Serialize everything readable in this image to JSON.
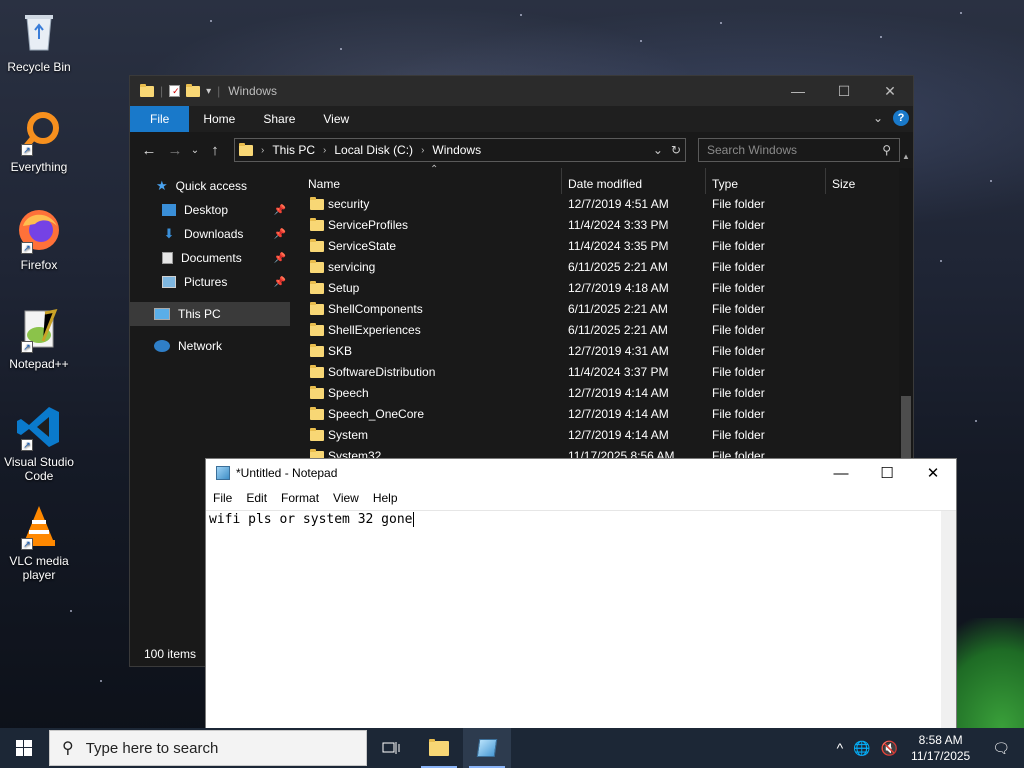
{
  "desktop": {
    "icons": [
      {
        "label": "Recycle Bin",
        "icon": "recycle-bin-icon"
      },
      {
        "label": "Everything",
        "icon": "everything-search-icon"
      },
      {
        "label": "Firefox",
        "icon": "firefox-icon"
      },
      {
        "label": "Notepad++",
        "icon": "notepadpp-icon"
      },
      {
        "label": "Visual Studio Code",
        "icon": "vscode-icon"
      },
      {
        "label": "VLC media player",
        "icon": "vlc-icon"
      }
    ]
  },
  "explorer": {
    "title": "Windows",
    "ribbon": {
      "file": "File",
      "home": "Home",
      "share": "Share",
      "view": "View"
    },
    "address": {
      "seg1": "This PC",
      "seg2": "Local Disk (C:)",
      "seg3": "Windows"
    },
    "search_placeholder": "Search Windows",
    "nav": {
      "quick_access": "Quick access",
      "desktop": "Desktop",
      "downloads": "Downloads",
      "documents": "Documents",
      "pictures": "Pictures",
      "this_pc": "This PC",
      "network": "Network"
    },
    "columns": {
      "name": "Name",
      "date": "Date modified",
      "type": "Type",
      "size": "Size"
    },
    "rows": [
      {
        "name": "security",
        "date": "12/7/2019 4:51 AM",
        "type": "File folder"
      },
      {
        "name": "ServiceProfiles",
        "date": "11/4/2024 3:33 PM",
        "type": "File folder"
      },
      {
        "name": "ServiceState",
        "date": "11/4/2024 3:35 PM",
        "type": "File folder"
      },
      {
        "name": "servicing",
        "date": "6/11/2025 2:21 AM",
        "type": "File folder"
      },
      {
        "name": "Setup",
        "date": "12/7/2019 4:18 AM",
        "type": "File folder"
      },
      {
        "name": "ShellComponents",
        "date": "6/11/2025 2:21 AM",
        "type": "File folder"
      },
      {
        "name": "ShellExperiences",
        "date": "6/11/2025 2:21 AM",
        "type": "File folder"
      },
      {
        "name": "SKB",
        "date": "12/7/2019 4:31 AM",
        "type": "File folder"
      },
      {
        "name": "SoftwareDistribution",
        "date": "11/4/2024 3:37 PM",
        "type": "File folder"
      },
      {
        "name": "Speech",
        "date": "12/7/2019 4:14 AM",
        "type": "File folder"
      },
      {
        "name": "Speech_OneCore",
        "date": "12/7/2019 4:14 AM",
        "type": "File folder"
      },
      {
        "name": "System",
        "date": "12/7/2019 4:14 AM",
        "type": "File folder"
      },
      {
        "name": "System32",
        "date": "11/17/2025 8:56 AM",
        "type": "File folder"
      }
    ],
    "status": "100 items"
  },
  "notepad": {
    "title": "*Untitled - Notepad",
    "menu": {
      "file": "File",
      "edit": "Edit",
      "format": "Format",
      "view": "View",
      "help": "Help"
    },
    "content": "wifi pls or system 32 gone"
  },
  "taskbar": {
    "search_placeholder": "Type here to search",
    "time": "8:58 AM",
    "date": "11/17/2025"
  },
  "colors": {
    "ribbon_file": "#1979ca",
    "taskbar": "#1c2736",
    "explorer_bg": "#191919"
  }
}
